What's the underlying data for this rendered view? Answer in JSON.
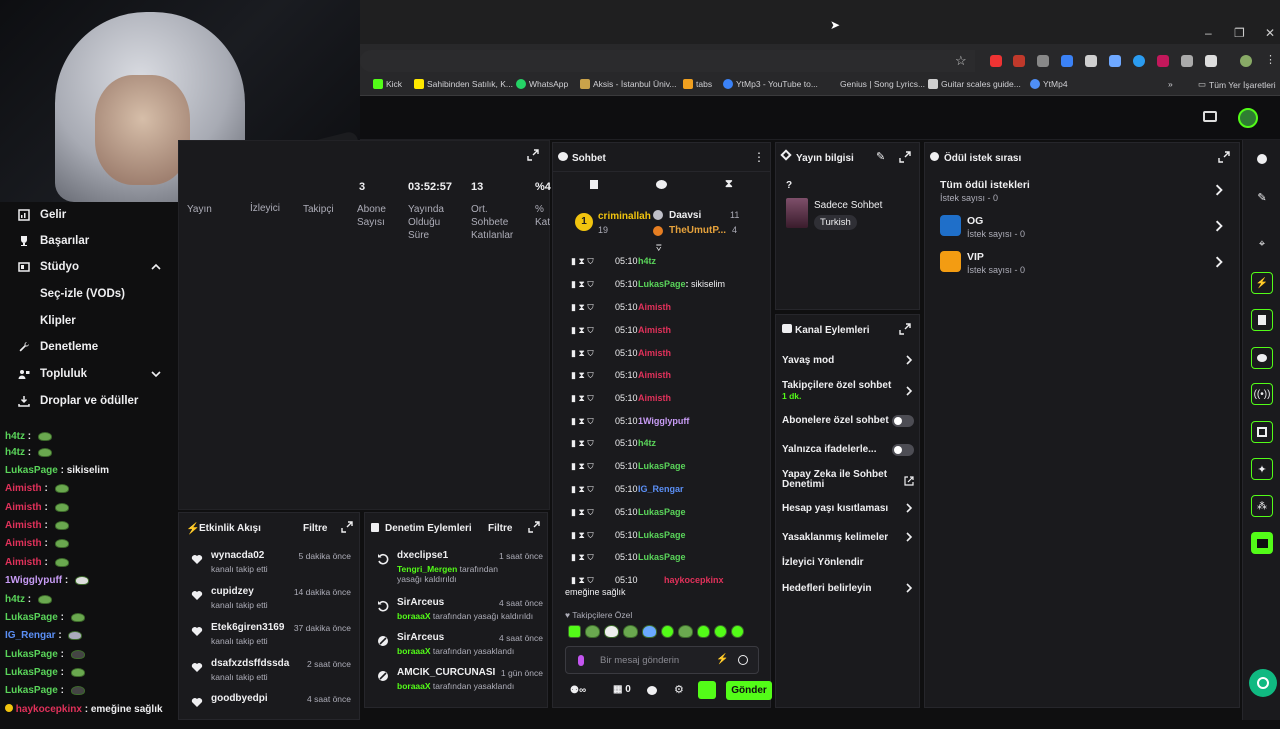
{
  "browser": {
    "bookmarks": [
      {
        "label": "Kick",
        "color": "#53fc18"
      },
      {
        "label": "Sahibinden Satılık, K...",
        "color": "#ffe800"
      },
      {
        "label": "WhatsApp",
        "color": "#25d366"
      },
      {
        "label": "Aksis - İstanbul Üniv...",
        "color": "#c9a24a"
      },
      {
        "label": "tabs",
        "color": "#f0a020"
      },
      {
        "label": "YtMp3 - YouTube to...",
        "color": "#3b82f6"
      },
      {
        "label": "Genius | Song Lyrics...",
        "color": "#28282a"
      },
      {
        "label": "Guitar scales guide...",
        "color": "#cfcfcf"
      },
      {
        "label": "YtMp4",
        "color": "#4f8ff7"
      }
    ],
    "more_bookmarks": "»",
    "all_bookmarks": "Tüm Yer İşaretleri"
  },
  "left_nav": {
    "items": [
      {
        "label": "Gelir",
        "icon": "chart-icon"
      },
      {
        "label": "Başarılar",
        "icon": "trophy-icon"
      },
      {
        "label": "Stüdyo",
        "icon": "studio-icon",
        "expanded": true
      },
      {
        "label": "Seç-izle (VODs)",
        "icon": ""
      },
      {
        "label": "Klipler",
        "icon": ""
      },
      {
        "label": "Denetleme",
        "icon": "wrench-icon"
      },
      {
        "label": "Topluluk",
        "icon": "community-icon",
        "expanded": false
      },
      {
        "label": "Droplar ve ödüller",
        "icon": "drops-icon"
      }
    ]
  },
  "left_chat": [
    {
      "user": "h4tz",
      "color": "#5ad45a",
      "msg": ""
    },
    {
      "user": "h4tz",
      "color": "#5ad45a",
      "msg": ""
    },
    {
      "user": "LukasPage",
      "color": "#5ad45a",
      "msg": "sikiselim"
    },
    {
      "user": "Aimisth",
      "color": "#e0315a",
      "msg": ""
    },
    {
      "user": "Aimisth",
      "color": "#e0315a",
      "msg": ""
    },
    {
      "user": "Aimisth",
      "color": "#e0315a",
      "msg": ""
    },
    {
      "user": "Aimisth",
      "color": "#e0315a",
      "msg": ""
    },
    {
      "user": "Aimisth",
      "color": "#e0315a",
      "msg": ""
    },
    {
      "user": "1Wigglypuff",
      "color": "#c89cf5",
      "msg": ""
    },
    {
      "user": "h4tz",
      "color": "#5ad45a",
      "msg": ""
    },
    {
      "user": "LukasPage",
      "color": "#5ad45a",
      "msg": ""
    },
    {
      "user": "IG_Rengar",
      "color": "#5b8ff5",
      "msg": ""
    },
    {
      "user": "LukasPage",
      "color": "#5ad45a",
      "msg": ""
    },
    {
      "user": "LukasPage",
      "color": "#5ad45a",
      "msg": ""
    },
    {
      "user": "LukasPage",
      "color": "#5ad45a",
      "msg": ""
    },
    {
      "user": "LukasPage",
      "color": "#5ad45a",
      "msg": ""
    }
  ],
  "left_chat_last": {
    "user": "haykocepkinx",
    "msg": "emeğine sağlık"
  },
  "stats": [
    {
      "value": "3",
      "label": "Yayın"
    },
    {
      "value": "",
      "label": "İzleyici"
    },
    {
      "value": "",
      "label": "Takipçi"
    },
    {
      "value": "",
      "label": "Abone Sayısı"
    },
    {
      "value": "03:52:57",
      "label": "Yayında Olduğu Süre"
    },
    {
      "value": "13",
      "label": "Ort. Sohbete Katılanlar"
    },
    {
      "value": "%4",
      "label": "% Kat"
    }
  ],
  "activity_feed": {
    "title": "Etkinlik Akışı",
    "filter": "Filtre",
    "items": [
      {
        "name": "wynacda02",
        "sub": "kanalı takip etti",
        "time": "5 dakika önce"
      },
      {
        "name": "cupidzey",
        "sub": "kanalı takip etti",
        "time": "14 dakika önce"
      },
      {
        "name": "Etek6giren3169",
        "sub": "kanalı takip etti",
        "time": "37 dakika önce"
      },
      {
        "name": "dsafxzdsffdssda",
        "sub": "kanalı takip etti",
        "time": "2 saat önce"
      },
      {
        "name": "goodbyedpi",
        "sub": "",
        "time": "4 saat önce"
      }
    ]
  },
  "mod_actions": {
    "title": "Denetim Eylemleri",
    "filter": "Filtre",
    "items": [
      {
        "name": "dxeclipse1",
        "by": "Tengri_Mergen",
        "action": "tarafından yasağı kaldırıldı",
        "time": "1 saat önce",
        "icon": "undo-icon"
      },
      {
        "name": "SirArceus",
        "by": "boraaaX",
        "action": "tarafından yasağı kaldırıldı",
        "time": "4 saat önce",
        "icon": "undo-icon"
      },
      {
        "name": "SirArceus",
        "by": "boraaaX",
        "action": "tarafından yasaklandı",
        "time": "4 saat önce",
        "icon": "ban-icon"
      },
      {
        "name": "AMCIK_CURCUNASI",
        "by": "boraaaX",
        "action": "tarafından yasaklandı",
        "time": "1 gün önce",
        "icon": "ban-icon"
      }
    ]
  },
  "chat": {
    "title": "Sohbet",
    "top_chatters": [
      {
        "name": "criminallah",
        "count": "19",
        "rank": "1"
      },
      {
        "name": "Daavsi",
        "count": "11"
      },
      {
        "name": "TheUmutP...",
        "count": "4"
      }
    ],
    "messages": [
      {
        "time": "05:10",
        "user": "h4tz",
        "color": "#5ad45a",
        "text": ""
      },
      {
        "time": "05:10",
        "user": "LukasPage",
        "color": "#5ad45a",
        "text": "sikiselim"
      },
      {
        "time": "05:10",
        "user": "Aimisth",
        "color": "#e0315a",
        "text": ""
      },
      {
        "time": "05:10",
        "user": "Aimisth",
        "color": "#e0315a",
        "text": ""
      },
      {
        "time": "05:10",
        "user": "Aimisth",
        "color": "#e0315a",
        "text": ""
      },
      {
        "time": "05:10",
        "user": "Aimisth",
        "color": "#e0315a",
        "text": ""
      },
      {
        "time": "05:10",
        "user": "Aimisth",
        "color": "#e0315a",
        "text": ""
      },
      {
        "time": "05:10",
        "user": "1Wigglypuff",
        "color": "#c89cf5",
        "text": ""
      },
      {
        "time": "05:10",
        "user": "h4tz",
        "color": "#5ad45a",
        "text": ""
      },
      {
        "time": "05:10",
        "user": "LukasPage",
        "color": "#5ad45a",
        "text": ""
      },
      {
        "time": "05:10",
        "user": "IG_Rengar",
        "color": "#5b8ff5",
        "text": ""
      },
      {
        "time": "05:10",
        "user": "LukasPage",
        "color": "#5ad45a",
        "text": ""
      },
      {
        "time": "05:10",
        "user": "LukasPage",
        "color": "#5ad45a",
        "text": ""
      },
      {
        "time": "05:10",
        "user": "LukasPage",
        "color": "#5ad45a",
        "text": ""
      }
    ],
    "last_message": {
      "time": "05:10",
      "user": "haykocepkinx",
      "color": "#e0315a",
      "text": "emeğine sağlık"
    },
    "followers_only": "Takipçilere Özel",
    "input_placeholder": "Bir mesaj gönderin",
    "send": "Gönder",
    "viewers": "∞",
    "count": "0"
  },
  "stream_info": {
    "title": "Yayın bilgisi",
    "question": "?",
    "category": "Sadece Sohbet",
    "tag": "Turkish"
  },
  "channel_actions": {
    "title": "Kanal Eylemleri",
    "items": [
      {
        "label": "Yavaş mod",
        "type": "chevron"
      },
      {
        "label": "Takipçilere özel sohbet",
        "sub": "1 dk.",
        "type": "chevron"
      },
      {
        "label": "Abonelere özel sohbet",
        "type": "toggle"
      },
      {
        "label": "Yalnızca ifadelerle...",
        "type": "toggle"
      },
      {
        "label": "Yapay Zeka ile Sohbet Denetimi",
        "type": "external"
      },
      {
        "label": "Hesap yaşı kısıtlaması",
        "type": "chevron"
      },
      {
        "label": "Yasaklanmış kelimeler",
        "type": "chevron"
      },
      {
        "label": "İzleyici Yönlendir",
        "type": "none"
      },
      {
        "label": "Hedefleri belirleyin",
        "type": "chevron"
      }
    ]
  },
  "rewards": {
    "title": "Ödül istek sırası",
    "items": [
      {
        "name": "Tüm ödül istekleri",
        "sub": "İstek sayısı - 0",
        "icon": ""
      },
      {
        "name": "OG",
        "sub": "İstek sayısı - 0",
        "icon": "phone-icon",
        "color": "#1f6fc9"
      },
      {
        "name": "VIP",
        "sub": "İstek sayısı - 0",
        "icon": "phone-icon",
        "color": "#f39c12"
      }
    ]
  },
  "colors": {
    "accent": "#53fc18",
    "panel": "#1a1a1d",
    "bg": "#0f0f10"
  }
}
